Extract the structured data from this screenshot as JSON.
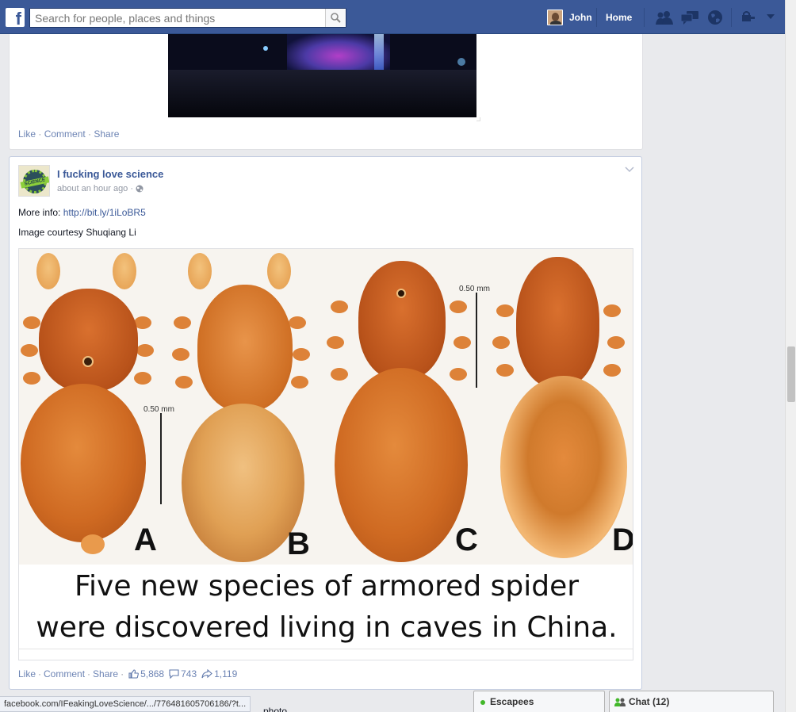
{
  "topbar": {
    "logo": "f",
    "search_placeholder": "Search for people, places and things",
    "user_name": "John",
    "home_label": "Home",
    "color": "#3b5998"
  },
  "prev_story": {
    "like": "Like",
    "comment": "Comment",
    "share": "Share"
  },
  "story": {
    "page_name": "I fucking love science",
    "time": "about an hour ago",
    "more_info_label": "More info:",
    "more_info_link": "http://bit.ly/1iLoBR5",
    "credit": "Image courtesy Shuqiang Li",
    "photo": {
      "scale_label_1": "0.50 mm",
      "scale_label_2": "0.50 mm",
      "letters": [
        "A",
        "B",
        "C",
        "D"
      ],
      "caption_line1": "Five new species of armored spider",
      "caption_line2": "were discovered living in caves in China."
    },
    "like": "Like",
    "comment": "Comment",
    "share": "Share",
    "like_count": "5,868",
    "comment_count": "743",
    "share_count": "1,119"
  },
  "statusbar": {
    "url": "facebook.com/IFeakingLoveScience/.../776481605706186/?t..."
  },
  "below_partial": "photo",
  "chat": {
    "group_label": "Escapees",
    "chat_label": "Chat (12)"
  }
}
